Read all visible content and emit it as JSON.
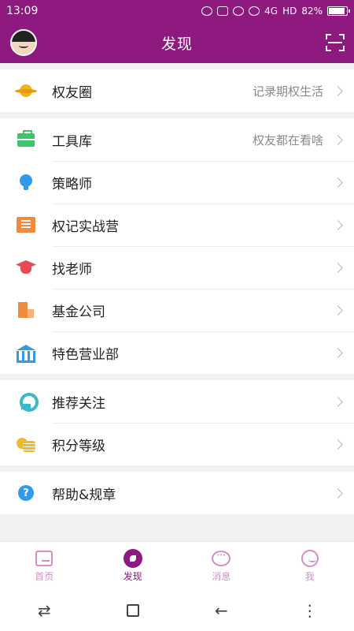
{
  "status_bar": {
    "time": "13:09",
    "network": "4G",
    "hd": "HD",
    "battery": "82%"
  },
  "header": {
    "title": "发现"
  },
  "groups": [
    {
      "items": [
        {
          "label": "权友圈",
          "hint": "记录期权生活",
          "icon": "planet-icon"
        }
      ]
    },
    {
      "items": [
        {
          "label": "工具库",
          "hint": "权友都在看啥",
          "icon": "toolbox-icon"
        },
        {
          "label": "策略师",
          "hint": "",
          "icon": "lightbulb-icon"
        },
        {
          "label": "权记实战营",
          "hint": "",
          "icon": "camp-icon"
        },
        {
          "label": "找老师",
          "hint": "",
          "icon": "graduation-cap-icon"
        },
        {
          "label": "基金公司",
          "hint": "",
          "icon": "building-icon"
        },
        {
          "label": "特色营业部",
          "hint": "",
          "icon": "bank-icon"
        }
      ]
    },
    {
      "items": [
        {
          "label": "推荐关注",
          "hint": "",
          "icon": "badge-icon"
        },
        {
          "label": "积分等级",
          "hint": "",
          "icon": "coins-icon"
        }
      ]
    },
    {
      "items": [
        {
          "label": "帮助&规章",
          "hint": "",
          "icon": "help-icon"
        }
      ]
    }
  ],
  "help_glyph": "?",
  "tab_bar": {
    "tabs": [
      {
        "label": "首页",
        "icon": "home-icon",
        "active": false
      },
      {
        "label": "发现",
        "icon": "discover-icon",
        "active": true
      },
      {
        "label": "消息",
        "icon": "message-icon",
        "active": false
      },
      {
        "label": "我",
        "icon": "profile-icon",
        "active": false
      }
    ],
    "message_glyph": "···"
  },
  "system_nav": {
    "switch_glyph": "⇄",
    "back_glyph": "←",
    "menu_glyph": "⋮"
  },
  "colors": {
    "brand": "#8e1a7f",
    "tab_inactive": "#d58fc6",
    "background": "#f2f2f2"
  }
}
